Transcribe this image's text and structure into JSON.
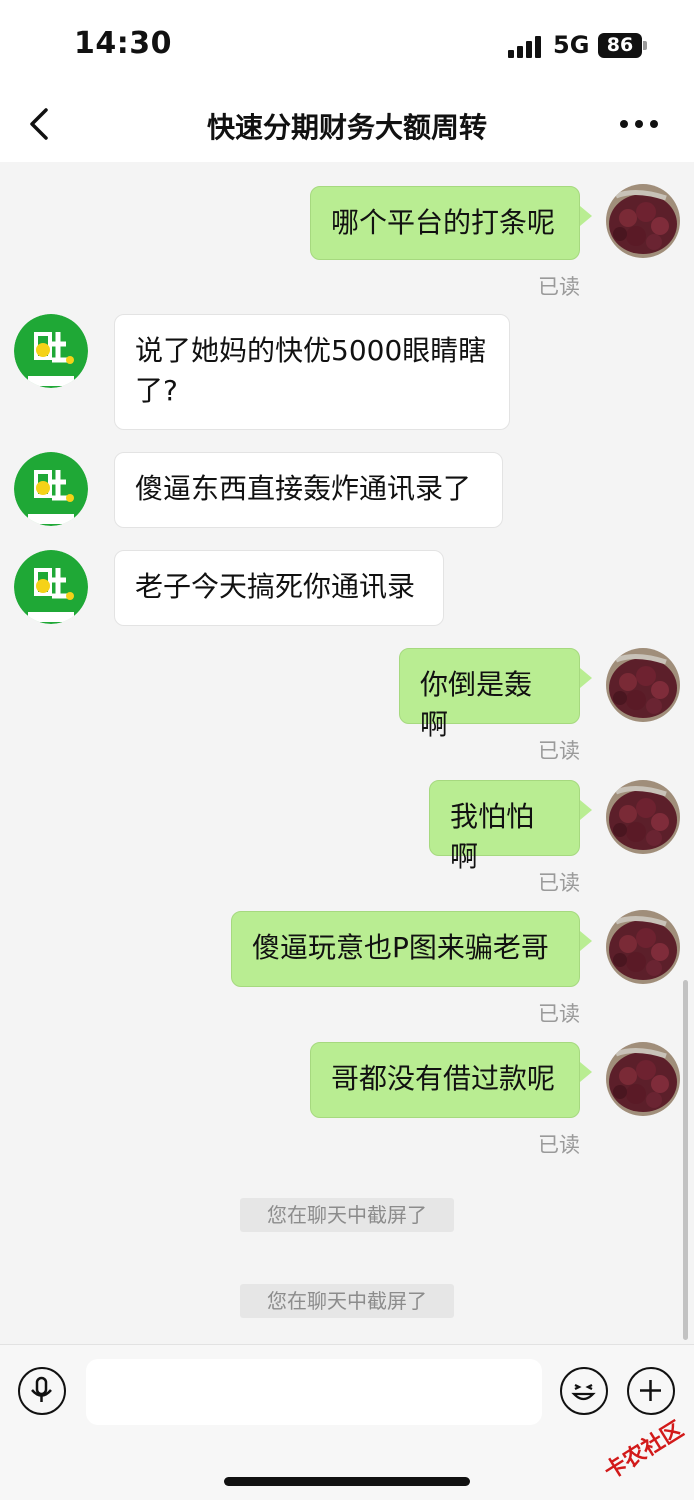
{
  "status": {
    "time": "14:30",
    "network": "5G",
    "battery": "86"
  },
  "header": {
    "title": "快速分期财务大额周转"
  },
  "messages": [
    {
      "side": "me",
      "text": "哪个平台的打条呢",
      "read": "已读"
    },
    {
      "side": "them",
      "text": "说了她妈的快优5000眼睛瞎了?"
    },
    {
      "side": "them",
      "text": "傻逼东西直接轰炸通讯录了"
    },
    {
      "side": "them",
      "text": "老子今天搞死你通讯录"
    },
    {
      "side": "me",
      "text": "你倒是轰啊",
      "read": "已读"
    },
    {
      "side": "me",
      "text": "我怕怕啊",
      "read": "已读"
    },
    {
      "side": "me",
      "text": "傻逼玩意也P图来骗老哥",
      "read": "已读"
    },
    {
      "side": "me",
      "text": "哥都没有借过款呢",
      "read": "已读"
    }
  ],
  "system_notices": [
    "您在聊天中截屏了",
    "您在聊天中截屏了"
  ],
  "icons": {
    "back": "back-chevron-icon",
    "more": "more-dots-icon",
    "voice": "microphone-icon",
    "emoji": "emoji-icon",
    "plus": "plus-icon"
  },
  "colors": {
    "my_bubble": "#b9ed92",
    "their_bubble": "#ffffff",
    "chat_bg": "#f4f4f4"
  },
  "watermark": "卡农社区"
}
